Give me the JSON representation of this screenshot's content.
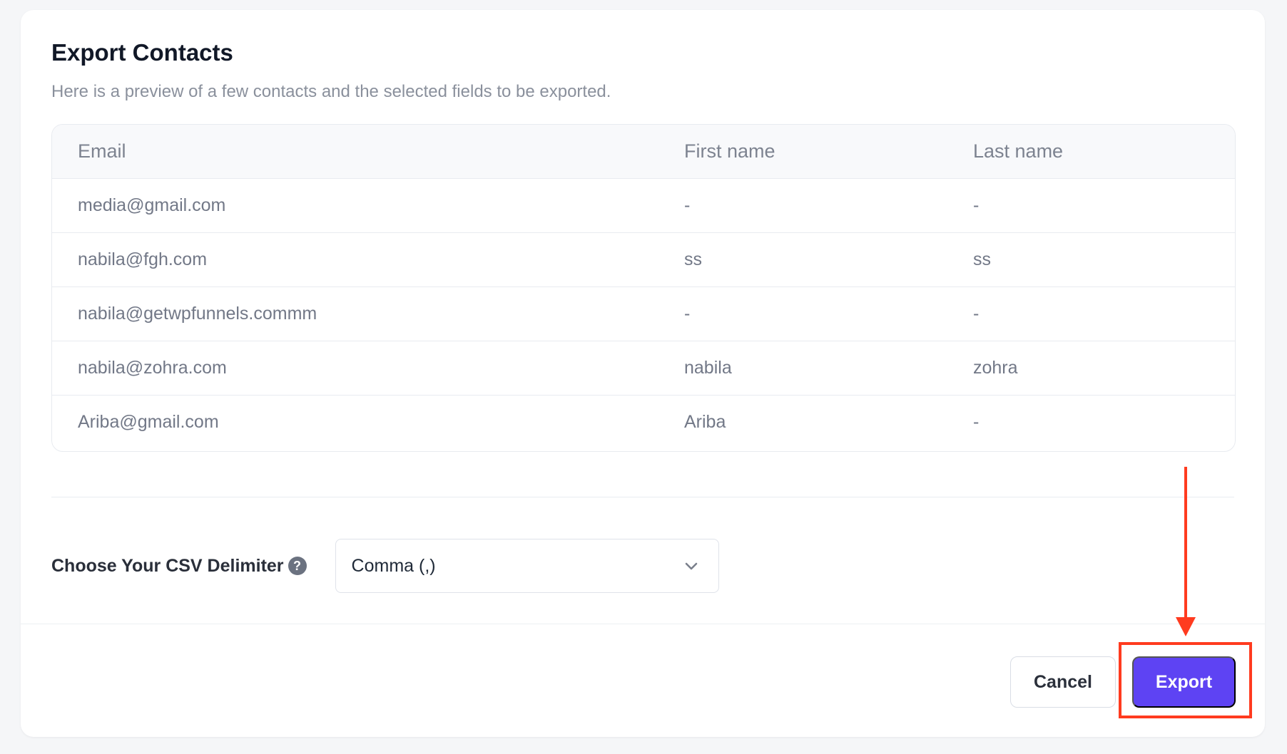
{
  "export_contacts": {
    "title": "Export Contacts",
    "subtitle": "Here is a preview of a few contacts and the selected fields to be exported."
  },
  "table": {
    "headers": [
      "Email",
      "First name",
      "Last name"
    ],
    "rows": [
      [
        "media@gmail.com",
        "-",
        "-"
      ],
      [
        "nabila@fgh.com",
        "ss",
        "ss"
      ],
      [
        "nabila@getwpfunnels.commm",
        "-",
        "-"
      ],
      [
        "nabila@zohra.com",
        "nabila",
        "zohra"
      ],
      [
        "Ariba@gmail.com",
        "Ariba",
        "-"
      ]
    ]
  },
  "delimiter": {
    "label": "Choose Your CSV Delimiter",
    "help_symbol": "?",
    "selected": "Comma (,)"
  },
  "actions": {
    "cancel_label": "Cancel",
    "export_label": "Export"
  },
  "theme": {
    "accent": "#5E43F3",
    "annotation": "#FF3B1F"
  }
}
